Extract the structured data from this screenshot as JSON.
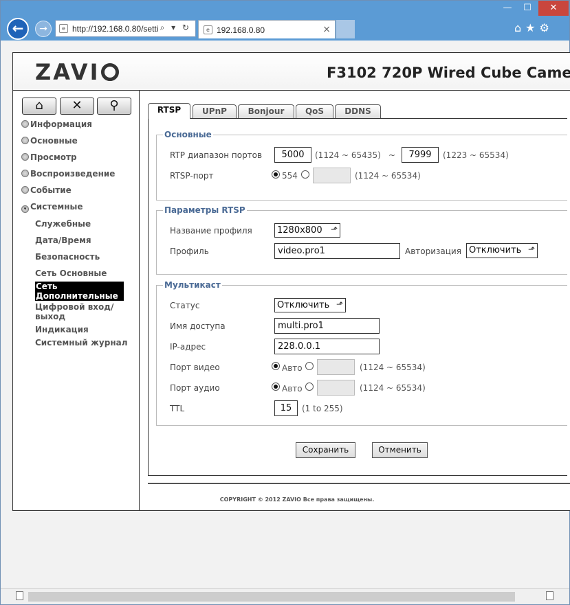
{
  "browser": {
    "address": "http://192.168.0.80/setti",
    "tab_title": "192.168.0.80",
    "tab_close": "×",
    "address_icons": "⌕ ▾ ↻",
    "back_glyph": "←",
    "forward_glyph": "→",
    "window_controls": {
      "minimize": "—",
      "maximize": "☐",
      "close": "✕"
    },
    "toolbar_icons": "⌂★⚙"
  },
  "header": {
    "logo": "ZAVI",
    "model": "F3102 720P Wired Cube Came"
  },
  "sidebar": {
    "top_buttons": [
      {
        "name": "home-icon",
        "glyph": "⌂"
      },
      {
        "name": "tools-icon",
        "glyph": "✕"
      },
      {
        "name": "search-icon",
        "glyph": "⚲"
      }
    ],
    "menu": [
      {
        "label": "Информация",
        "bullet": ""
      },
      {
        "label": "Основные",
        "bullet": ""
      },
      {
        "label": "Просмотр",
        "bullet": ""
      },
      {
        "label": "Воспроизведение",
        "bullet": ""
      },
      {
        "label": "Событие",
        "bullet": ""
      },
      {
        "label": "Системные",
        "bullet": "▾"
      }
    ],
    "submenu": [
      {
        "label": "Служебные"
      },
      {
        "label": "Дата/Время"
      },
      {
        "label": "Безопасность"
      },
      {
        "label": "Сеть Основные"
      },
      {
        "label": "Сеть Дополнительные",
        "active": true
      },
      {
        "label": "Цифровой вход/выход"
      },
      {
        "label": "Индикация"
      },
      {
        "label": "Системный журнал"
      }
    ]
  },
  "tabs": [
    "RTSP",
    "UPnP",
    "Bonjour",
    "QoS",
    "DDNS"
  ],
  "basic": {
    "legend": "Основные",
    "rtp_range_label": "RTP диапазон портов",
    "rtp_start": "5000",
    "rtp_start_range": "(1124 ~ 65435)",
    "tilde": "~",
    "rtp_end": "7999",
    "rtp_end_range": "(1223 ~ 65534)",
    "rtsp_port_label": "RTSP-порт",
    "rtsp_default": "554",
    "rtsp_custom_value": "",
    "rtsp_range": "(1124 ~ 65534)"
  },
  "rtsp_params": {
    "legend": "Параметры RTSP",
    "profile_name_label": "Название профиля",
    "profile_name_value": "1280x800",
    "profile_label": "Профиль",
    "profile_value": "video.pro1",
    "auth_label": "Авторизация",
    "auth_value": "Отключить"
  },
  "multicast": {
    "legend": "Мультикаст",
    "status_label": "Статус",
    "status_value": "Отключить",
    "access_name_label": "Имя доступа",
    "access_name_value": "multi.pro1",
    "ip_label": "IP-адрес",
    "ip_value": "228.0.0.1",
    "video_port_label": "Порт видео",
    "video_auto": "Авто",
    "video_range": "(1124 ~ 65534)",
    "audio_port_label": "Порт аудио",
    "audio_auto": "Авто",
    "audio_range": "(1124 ~ 65534)",
    "ttl_label": "TTL",
    "ttl_value": "15",
    "ttl_range": "(1 to 255)"
  },
  "actions": {
    "save": "Сохранить",
    "cancel": "Отменить"
  },
  "footer": {
    "copyright": "COPYRIGHT © 2012 ZAVIO Все права защищены."
  },
  "dropdown_arrow": "⬏"
}
